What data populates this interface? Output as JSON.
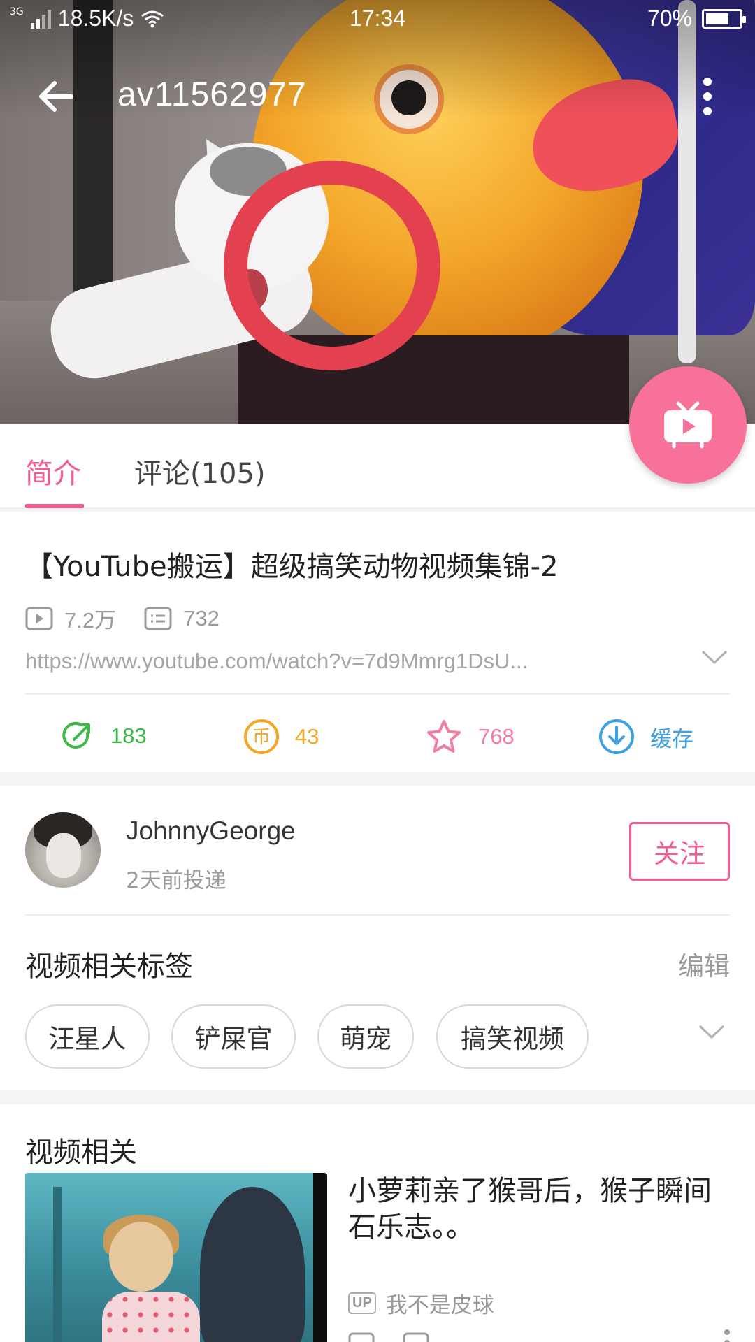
{
  "status_bar": {
    "network": "3G",
    "speed": "18.5K/s",
    "time": "17:34",
    "battery": "70%",
    "battery_level": 0.7
  },
  "toolbar": {
    "title": "av11562977",
    "back_icon": "back-arrow-icon",
    "more_icon": "more-vertical-icon"
  },
  "tabs": [
    {
      "label": "简介",
      "active": true
    },
    {
      "label": "评论(105)",
      "active": false
    }
  ],
  "video": {
    "title": "【YouTube搬运】超级搞笑动物视频集锦-2",
    "views": "7.2万",
    "danmaku": "732",
    "source_url": "https://www.youtube.com/watch?v=7d9Mmrg1DsU..."
  },
  "actions": [
    {
      "name": "share",
      "icon": "share-icon",
      "value": "183",
      "color": "#3bbb45"
    },
    {
      "name": "coin",
      "icon": "coin-icon",
      "value": "43",
      "color": "#f5a623"
    },
    {
      "name": "favorite",
      "icon": "star-icon",
      "value": "768",
      "color": "#f27ea0"
    },
    {
      "name": "cache",
      "icon": "download-icon",
      "value": "缓存",
      "color": "#3ea1e6"
    }
  ],
  "uploader": {
    "name": "JohnnyGeorge",
    "time": "2天前投递",
    "follow_label": "关注"
  },
  "tags": {
    "title": "视频相关标签",
    "edit_label": "编辑",
    "items": [
      "汪星人",
      "铲屎官",
      "萌宠",
      "搞笑视频"
    ]
  },
  "related": {
    "title": "视频相关",
    "items": [
      {
        "title": "小萝莉亲了猴哥后，猴子瞬间石乐志。。",
        "uploader_badge": "UP",
        "uploader": "我不是皮球"
      }
    ]
  },
  "colors": {
    "accent": "#f25d8e",
    "play_fab": "#f77199"
  }
}
